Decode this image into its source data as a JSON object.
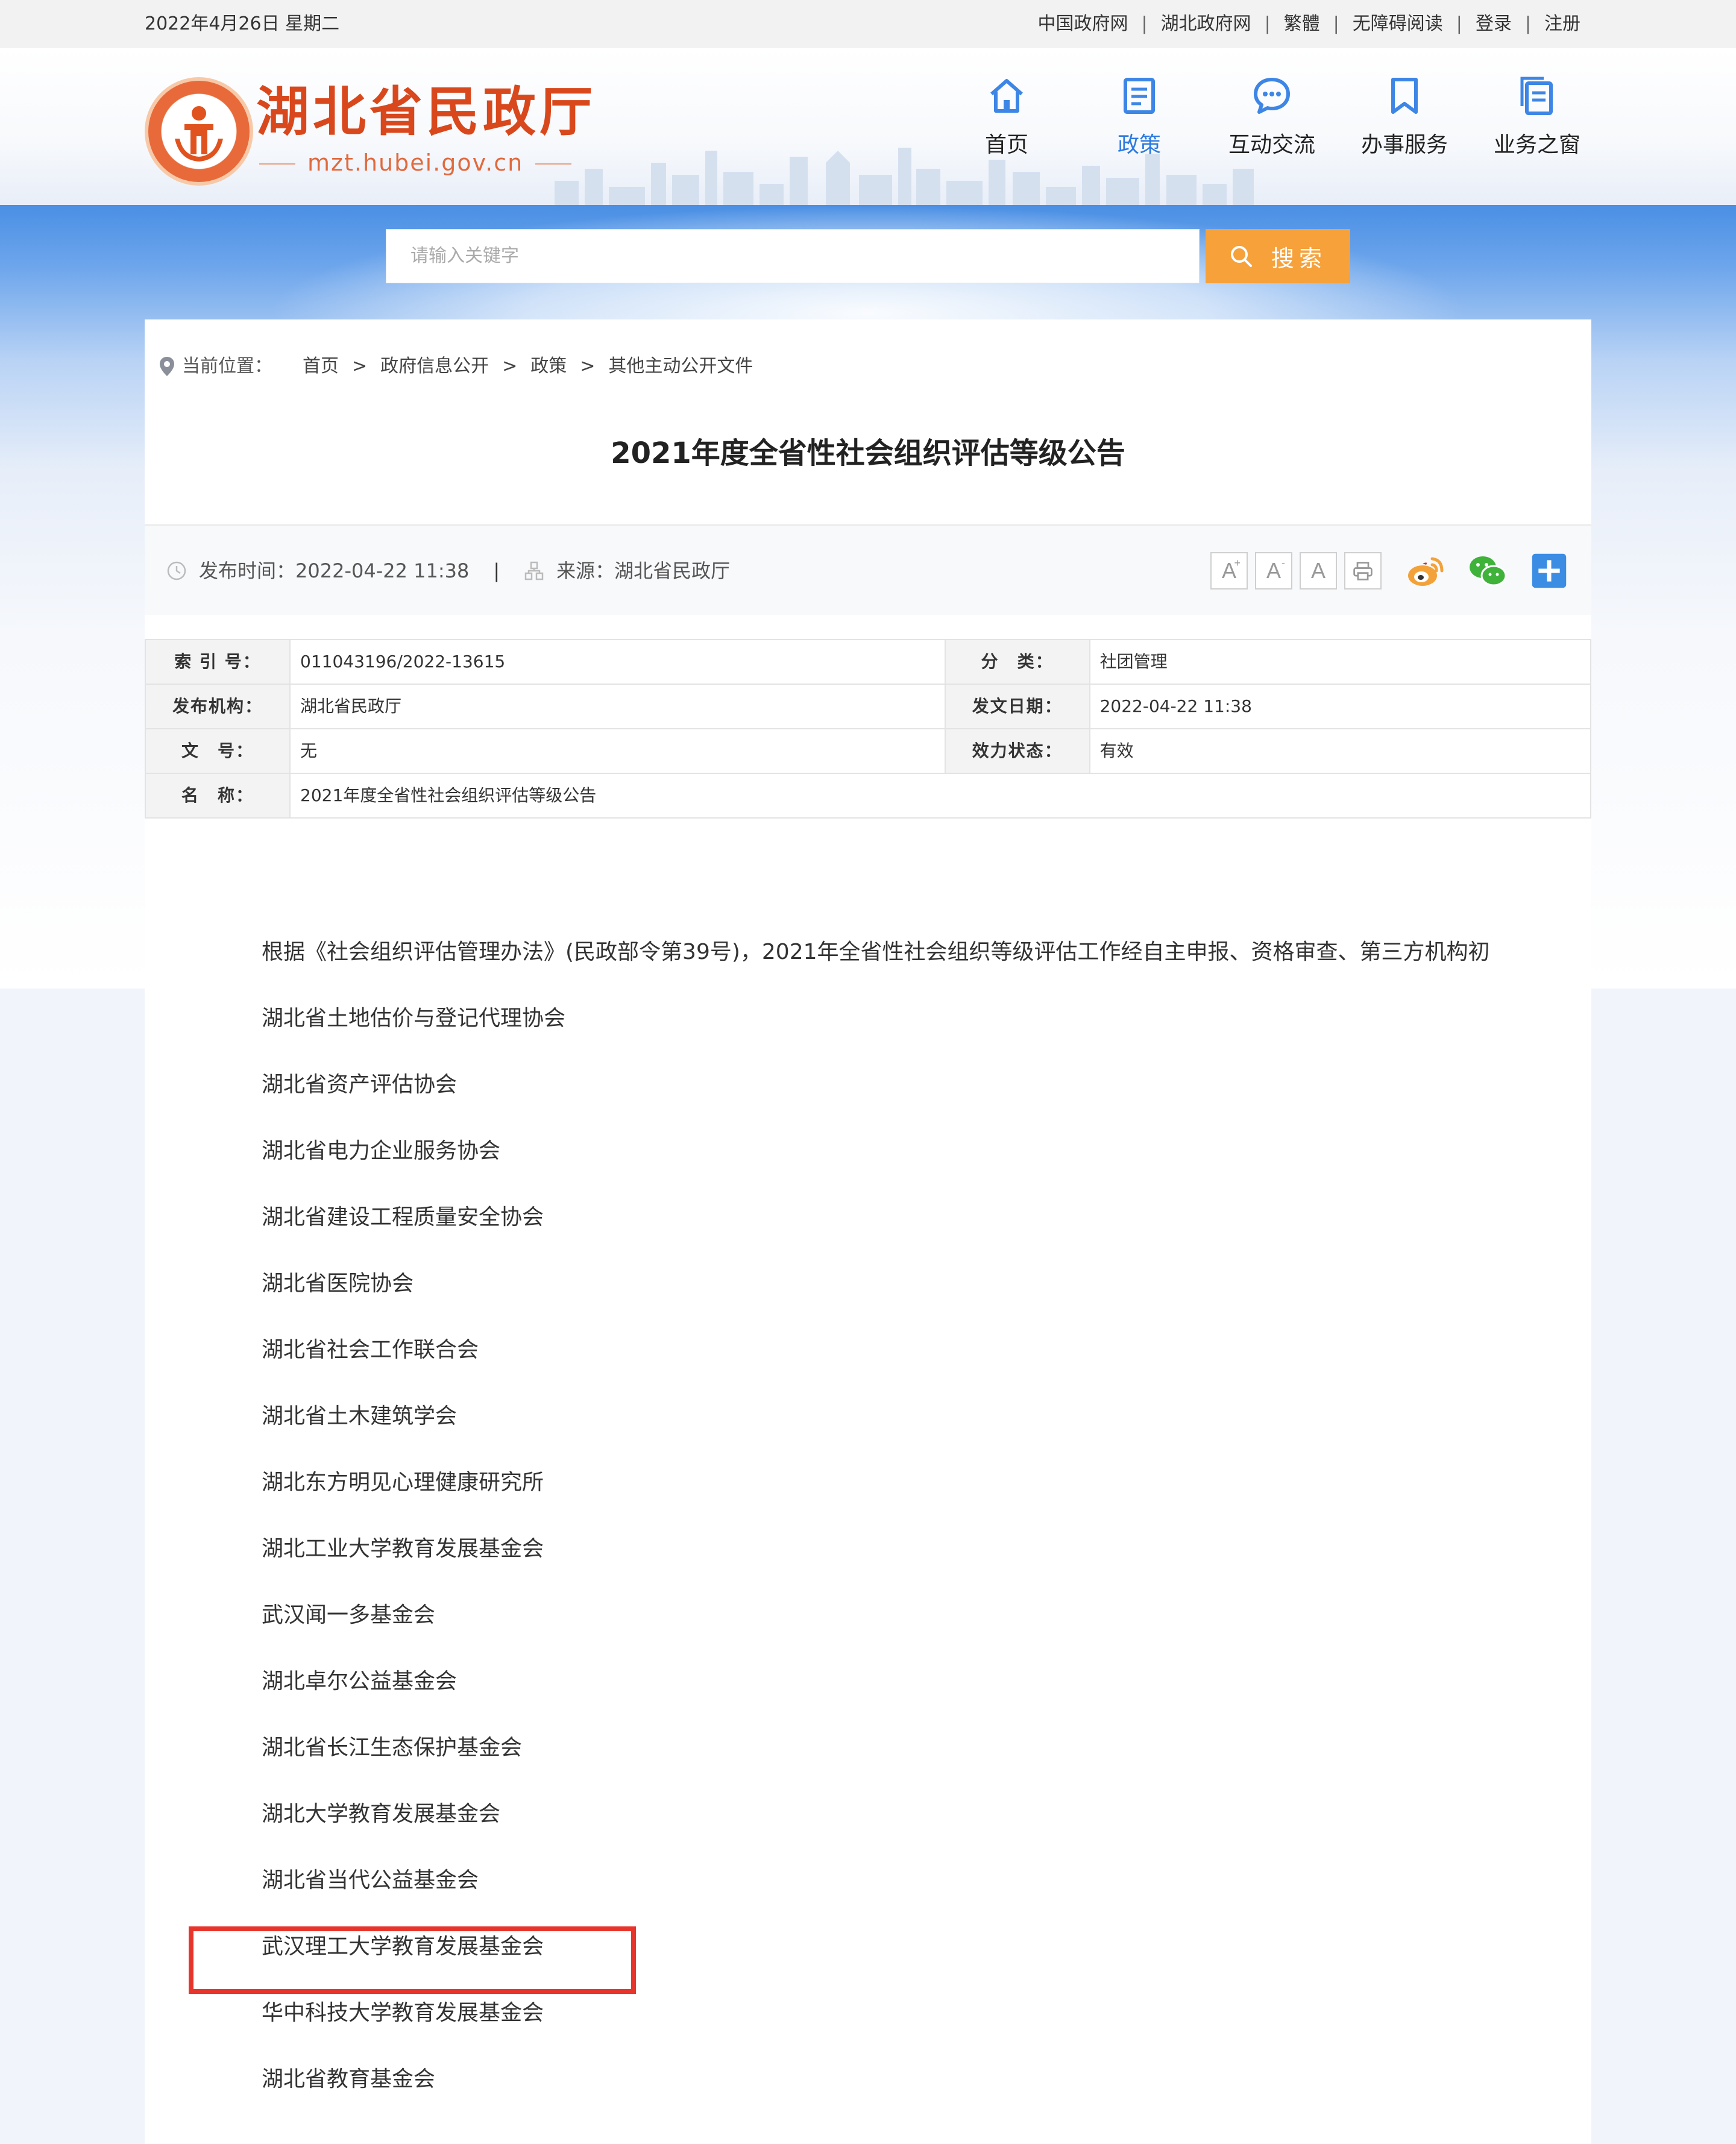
{
  "topbar": {
    "date": "2022年4月26日 星期二",
    "links": [
      "中国政府网",
      "湖北政府网",
      "繁體",
      "无障碍阅读",
      "登录",
      "注册"
    ],
    "separator": "|"
  },
  "logo": {
    "name": "湖北省民政厅",
    "domain": "mzt.hubei.gov.cn"
  },
  "nav": {
    "items": [
      {
        "label": "首页",
        "icon": "home-icon"
      },
      {
        "label": "政策",
        "icon": "document-icon",
        "active": true
      },
      {
        "label": "互动交流",
        "icon": "chat-icon"
      },
      {
        "label": "办事服务",
        "icon": "bookmark-icon"
      },
      {
        "label": "业务之窗",
        "icon": "files-icon"
      }
    ],
    "accent": "#2b7ae0"
  },
  "search": {
    "placeholder": "请输入关键字",
    "button": "搜索",
    "button_color": "#f6a13a"
  },
  "breadcrumb": {
    "lead": "当前位置：",
    "items": [
      "首页",
      "政府信息公开",
      "政策",
      "其他主动公开文件"
    ],
    "separator": ">"
  },
  "article": {
    "title": "2021年度全省性社会组织评估等级公告",
    "published_label": "发布时间：",
    "published": "2022-04-22 11:38",
    "divider": "|",
    "source_label": "来源：",
    "source": "湖北省民政厅"
  },
  "tools": {
    "font_larger": "A",
    "font_smaller": "A",
    "font_default": "A",
    "icons": [
      "print-icon",
      "weibo-icon",
      "wechat-icon",
      "share-plus-icon"
    ]
  },
  "info": {
    "index_label": "索 引 号：",
    "index": "011043196/2022-13615",
    "category_label": "分　类：",
    "category": "社团管理",
    "publisher_label": "发布机构：",
    "publisher": "湖北省民政厅",
    "date_label": "发文日期：",
    "date": "2022-04-22 11:38",
    "docno_label": "文　号：",
    "docno": "无",
    "status_label": "效力状态：",
    "status": "有效",
    "name_label": "名　称：",
    "name": "2021年度全省性社会组织评估等级公告"
  },
  "body": {
    "intro": "根据《社会组织评估管理办法》(民政部令第39号)，2021年全省性社会组织等级评估工作经自主申报、资格审查、第三方机构初",
    "orgs": [
      "湖北省土地估价与登记代理协会",
      "湖北省资产评估协会",
      "湖北省电力企业服务协会",
      "湖北省建设工程质量安全协会",
      "湖北省医院协会",
      "湖北省社会工作联合会",
      "湖北省土木建筑学会",
      "湖北东方明见心理健康研究所",
      "湖北工业大学教育发展基金会",
      "武汉闻一多基金会",
      "湖北卓尔公益基金会",
      "湖北省长江生态保护基金会",
      "湖北大学教育发展基金会",
      "湖北省当代公益基金会",
      "武汉理工大学教育发展基金会",
      "华中科技大学教育发展基金会",
      "湖北省教育基金会"
    ],
    "highlight_color": "#e8352b"
  }
}
